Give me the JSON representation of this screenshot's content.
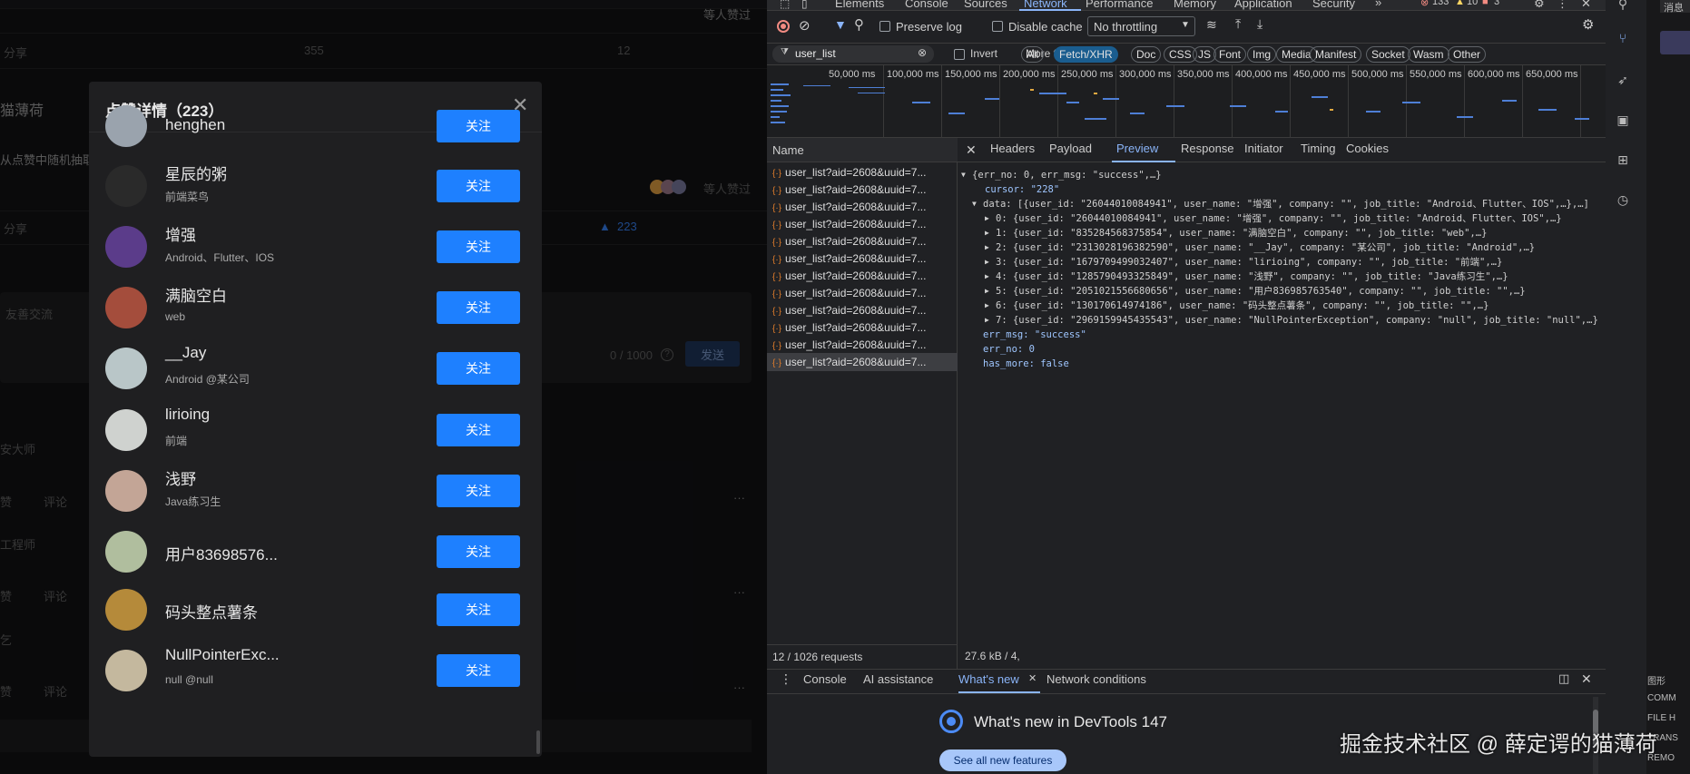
{
  "left_page": {
    "share_label": "分享",
    "stat_355": "355",
    "stat_12": "12",
    "author_frag": "猫薄荷",
    "body_frag": "从点赞中随机抽取",
    "liked_suffix": "等人赞过",
    "liked_suffix_top": "等人赞过",
    "like_count": "223",
    "comment_placeholder": "友善交流",
    "char_counter": "0 / 1000",
    "send_label": "发送",
    "commenter_1": "安大师",
    "commenter_2": "工程师",
    "commenter_3": "乞",
    "reply_label": "评论",
    "like_label": "赞",
    "more_label": "···"
  },
  "modal": {
    "title": "点赞详情（223）",
    "follow_label": "关注",
    "users": [
      {
        "name": "henghen",
        "job": ""
      },
      {
        "name": "星辰的粥",
        "job": "前端菜鸟"
      },
      {
        "name": "增强",
        "job": "Android、Flutter、IOS"
      },
      {
        "name": "满脑空白",
        "job": "web"
      },
      {
        "name": "__Jay",
        "job": "Android @某公司"
      },
      {
        "name": "lirioing",
        "job": "前端"
      },
      {
        "name": "浅野",
        "job": "Java练习生"
      },
      {
        "name": "用户83698576...",
        "job": ""
      },
      {
        "name": "码头整点薯条",
        "job": ""
      },
      {
        "name": "NullPointerExc...",
        "job": "null @null"
      }
    ]
  },
  "devtools": {
    "main_tabs": [
      "Elements",
      "Console",
      "Sources",
      "Network",
      "Performance",
      "Memory",
      "Application",
      "Security"
    ],
    "more_tabs": "»",
    "error_count": "133",
    "warning_count": "10",
    "info_count": "3",
    "preserve_log": "Preserve log",
    "disable_cache": "Disable cache",
    "throttling": "No throttling",
    "filter_value": "user_list",
    "invert": "Invert",
    "more_filters": "More filters",
    "type_chips": [
      "All",
      "Fetch/XHR",
      "Doc",
      "CSS",
      "JS",
      "Font",
      "Img",
      "Media",
      "Manifest",
      "Socket",
      "Wasm",
      "Other"
    ],
    "timeline_ticks": [
      "50,000 ms",
      "100,000 ms",
      "150,000 ms",
      "200,000 ms",
      "250,000 ms",
      "300,000 ms",
      "350,000 ms",
      "400,000 ms",
      "450,000 ms",
      "500,000 ms",
      "550,000 ms",
      "600,000 ms",
      "650,000 ms"
    ],
    "name_header": "Name",
    "request_name": "user_list?aid=2608&uuid=7...",
    "requests_count": 12,
    "detail_tabs": [
      "Headers",
      "Payload",
      "Preview",
      "Response",
      "Initiator",
      "Timing",
      "Cookies"
    ],
    "status_requests": "12 / 1026 requests",
    "status_size": "27.6 kB / 4,",
    "json_lines": [
      "{err_no: 0, err_msg: \"success\",…}",
      "cursor: \"228\"",
      "data: [{user_id: \"26044010084941\", user_name: \"增强\", company: \"\", job_title: \"Android、Flutter、IOS\",…},…]",
      "0: {user_id: \"26044010084941\", user_name: \"增强\", company: \"\", job_title: \"Android、Flutter、IOS\",…}",
      "1: {user_id: \"835284568375854\", user_name: \"满脑空白\", company: \"\", job_title: \"web\",…}",
      "2: {user_id: \"2313028196382590\", user_name: \"__Jay\", company: \"某公司\", job_title: \"Android\",…}",
      "3: {user_id: \"1679709499032407\", user_name: \"lirioing\", company: \"\", job_title: \"前端\",…}",
      "4: {user_id: \"1285790493325849\", user_name: \"浅野\", company: \"\", job_title: \"Java练习生\",…}",
      "5: {user_id: \"2051021556680656\", user_name: \"用户836985763540\", company: \"\", job_title: \"\",…}",
      "6: {user_id: \"130170614974186\", user_name: \"码头整点薯条\", company: \"\", job_title: \"\",…}",
      "7: {user_id: \"2969159945435543\", user_name: \"NullPointerException\", company: \"null\", job_title: \"null\",…}",
      "err_msg: \"success\"",
      "err_no: 0",
      "has_more: false"
    ],
    "drawer_tabs": [
      "Console",
      "AI assistance",
      "What's new",
      "Network conditions"
    ],
    "whats_new_title": "What's new in DevTools 147",
    "see_all": "See all new features"
  },
  "right_strip": {
    "search_frag": "消息",
    "items": [
      "图形",
      "COMM",
      "FILE H",
      "TRANS",
      "REMO"
    ]
  },
  "watermark": "掘金技术社区 @ 薛定谔的猫薄荷"
}
